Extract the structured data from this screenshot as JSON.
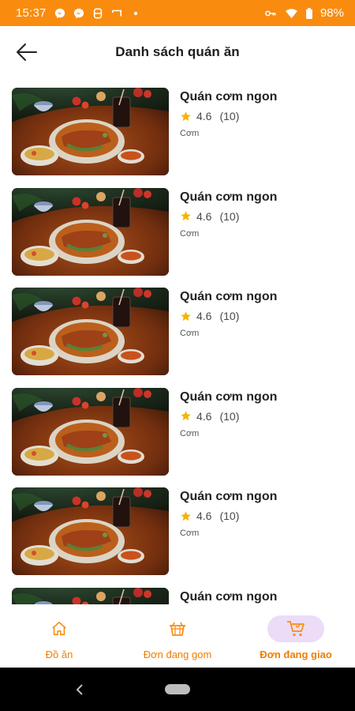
{
  "status_bar": {
    "time": "15:37",
    "battery": "98%",
    "background": "#f98c0f",
    "icons": [
      "messenger-icon",
      "messenger-icon",
      "notification-icon",
      "cast-icon",
      "dot-icon",
      "vpn-key-icon",
      "wifi-icon",
      "battery-icon"
    ]
  },
  "header": {
    "title": "Danh sách quán ăn",
    "back_icon": "arrow-left-icon"
  },
  "restaurants": [
    {
      "name": "Quán cơm ngon",
      "rating": "4.6",
      "count": "(10)",
      "category": "Cơm"
    },
    {
      "name": "Quán cơm ngon",
      "rating": "4.6",
      "count": "(10)",
      "category": "Cơm"
    },
    {
      "name": "Quán cơm ngon",
      "rating": "4.6",
      "count": "(10)",
      "category": "Cơm"
    },
    {
      "name": "Quán cơm ngon",
      "rating": "4.6",
      "count": "(10)",
      "category": "Cơm"
    },
    {
      "name": "Quán cơm ngon",
      "rating": "4.6",
      "count": "(10)",
      "category": "Cơm"
    },
    {
      "name": "Quán cơm ngon",
      "rating": "",
      "count": "",
      "category": ""
    }
  ],
  "bottom_nav": {
    "tabs": [
      {
        "label": "Đồ ăn",
        "icon": "home-icon",
        "active": false
      },
      {
        "label": "Đơn đang gom",
        "icon": "basket-icon",
        "active": false
      },
      {
        "label": "Đơn đang giao",
        "icon": "cart-icon",
        "active": true
      }
    ],
    "accent": "#f98c0f",
    "active_pill": "#ecdcf8"
  }
}
